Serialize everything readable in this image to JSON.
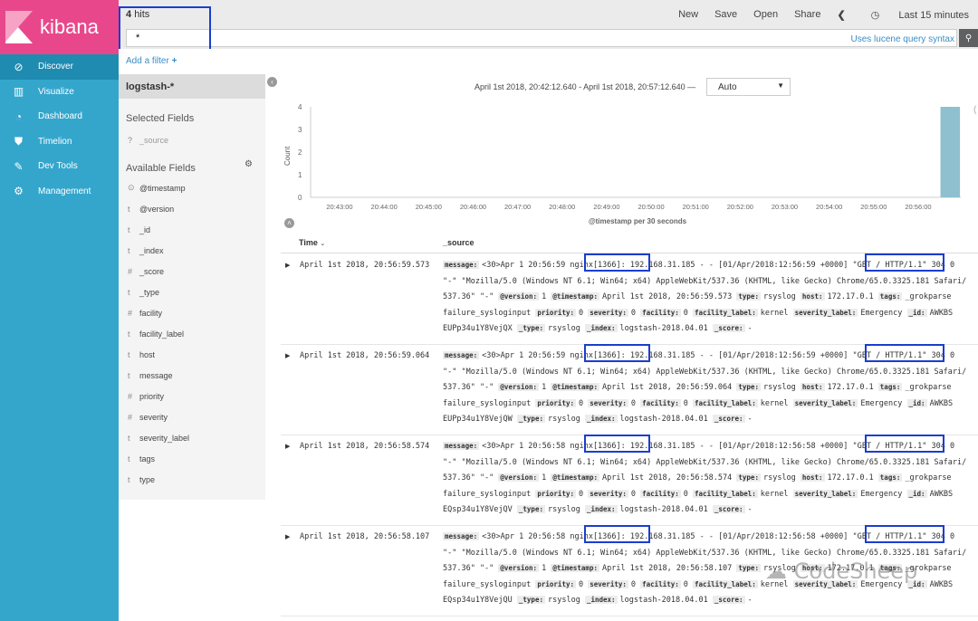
{
  "app": {
    "name": "kibana"
  },
  "nav": [
    {
      "label": "Discover",
      "icon": "compass-icon",
      "glyph": "⊘"
    },
    {
      "label": "Visualize",
      "icon": "bar-chart-icon",
      "glyph": "▥"
    },
    {
      "label": "Dashboard",
      "icon": "dashboard-icon",
      "glyph": "◔"
    },
    {
      "label": "Timelion",
      "icon": "timelion-icon",
      "glyph": "⛊"
    },
    {
      "label": "Dev Tools",
      "icon": "wrench-icon",
      "glyph": "✎"
    },
    {
      "label": "Management",
      "icon": "gear-icon",
      "glyph": "⚙"
    }
  ],
  "topbar": {
    "hits_count": "4",
    "hits_label": "hits",
    "actions": [
      "New",
      "Save",
      "Open",
      "Share"
    ],
    "time_picker": "Last 15 minutes"
  },
  "query": {
    "value": "*",
    "hint": "Uses lucene query syntax"
  },
  "filter": {
    "add_label": "Add a filter"
  },
  "sidebar": {
    "index_pattern": "logstash-*",
    "selected_title": "Selected Fields",
    "selected_fields": [
      {
        "type": "?",
        "name": "_source"
      }
    ],
    "available_title": "Available Fields",
    "available_fields": [
      {
        "type": "⊙",
        "name": "@timestamp"
      },
      {
        "type": "t",
        "name": "@version"
      },
      {
        "type": "t",
        "name": "_id"
      },
      {
        "type": "t",
        "name": "_index"
      },
      {
        "type": "#",
        "name": "_score"
      },
      {
        "type": "t",
        "name": "_type"
      },
      {
        "type": "#",
        "name": "facility"
      },
      {
        "type": "t",
        "name": "facility_label"
      },
      {
        "type": "t",
        "name": "host"
      },
      {
        "type": "t",
        "name": "message"
      },
      {
        "type": "#",
        "name": "priority"
      },
      {
        "type": "#",
        "name": "severity"
      },
      {
        "type": "t",
        "name": "severity_label"
      },
      {
        "type": "t",
        "name": "tags"
      },
      {
        "type": "t",
        "name": "type"
      }
    ]
  },
  "histogram": {
    "time_range": "April 1st 2018, 20:42:12.640 - April 1st 2018, 20:57:12.640 —",
    "interval": "Auto"
  },
  "chart_data": {
    "type": "bar",
    "ylabel": "Count",
    "xlabel": "@timestamp per 30 seconds",
    "ylim": [
      0,
      4
    ],
    "yticks": [
      "0",
      "1",
      "2",
      "3",
      "4"
    ],
    "xticks": [
      "20:43:00",
      "20:44:00",
      "20:45:00",
      "20:46:00",
      "20:47:00",
      "20:48:00",
      "20:49:00",
      "20:50:00",
      "20:51:00",
      "20:52:00",
      "20:53:00",
      "20:54:00",
      "20:55:00",
      "20:56:00"
    ],
    "bars": [
      {
        "x": "20:56:30",
        "value": 4
      }
    ],
    "bar_color": "#8ec0d0"
  },
  "table": {
    "col_time": "Time",
    "col_source": "_source",
    "rows": [
      {
        "time": "April 1st 2018, 20:56:59.573",
        "lines": [
          [
            [
              "k",
              "message:"
            ],
            [
              "v",
              "<30>Apr 1 20:56:59 nginx[1366]: 192.168.31.185 - - [01/Apr/2018:12:56:59 +0000] \"GET / HTTP/1.1\" 304 0"
            ]
          ],
          [
            [
              "v",
              "\"-\" \"Mozilla/5.0 (Windows NT 6.1; Win64; x64) AppleWebKit/537.36 (KHTML, like Gecko) Chrome/65.0.3325.181 Safari/"
            ]
          ],
          [
            [
              "v",
              "537.36\" \"-\" "
            ],
            [
              "k",
              "@version:"
            ],
            [
              "v",
              "1 "
            ],
            [
              "k",
              "@timestamp:"
            ],
            [
              "v",
              "April 1st 2018, 20:56:59.573 "
            ],
            [
              "k",
              "type:"
            ],
            [
              "v",
              "rsyslog "
            ],
            [
              "k",
              "host:"
            ],
            [
              "v",
              "172.17.0.1 "
            ],
            [
              "k",
              "tags:"
            ],
            [
              "v",
              "_grokparse"
            ]
          ],
          [
            [
              "v",
              "failure_sysloginput "
            ],
            [
              "k",
              "priority:"
            ],
            [
              "v",
              "0 "
            ],
            [
              "k",
              "severity:"
            ],
            [
              "v",
              "0 "
            ],
            [
              "k",
              "facility:"
            ],
            [
              "v",
              "0 "
            ],
            [
              "k",
              "facility_label:"
            ],
            [
              "v",
              "kernel "
            ],
            [
              "k",
              "severity_label:"
            ],
            [
              "v",
              "Emergency "
            ],
            [
              "k",
              "_id:"
            ],
            [
              "v",
              "AWKBS"
            ]
          ],
          [
            [
              "v",
              "EUPp34u1Y8VejQX "
            ],
            [
              "k",
              "_type:"
            ],
            [
              "v",
              "rsyslog "
            ],
            [
              "k",
              "_index:"
            ],
            [
              "v",
              "logstash-2018.04.01 "
            ],
            [
              "k",
              "_score:"
            ],
            [
              "v",
              "-"
            ]
          ]
        ]
      },
      {
        "time": "April 1st 2018, 20:56:59.064",
        "lines": [
          [
            [
              "k",
              "message:"
            ],
            [
              "v",
              "<30>Apr 1 20:56:59 nginx[1366]: 192.168.31.185 - - [01/Apr/2018:12:56:59 +0000] \"GET / HTTP/1.1\" 304 0"
            ]
          ],
          [
            [
              "v",
              "\"-\" \"Mozilla/5.0 (Windows NT 6.1; Win64; x64) AppleWebKit/537.36 (KHTML, like Gecko) Chrome/65.0.3325.181 Safari/"
            ]
          ],
          [
            [
              "v",
              "537.36\" \"-\" "
            ],
            [
              "k",
              "@version:"
            ],
            [
              "v",
              "1 "
            ],
            [
              "k",
              "@timestamp:"
            ],
            [
              "v",
              "April 1st 2018, 20:56:59.064 "
            ],
            [
              "k",
              "type:"
            ],
            [
              "v",
              "rsyslog "
            ],
            [
              "k",
              "host:"
            ],
            [
              "v",
              "172.17.0.1 "
            ],
            [
              "k",
              "tags:"
            ],
            [
              "v",
              "_grokparse"
            ]
          ],
          [
            [
              "v",
              "failure_sysloginput "
            ],
            [
              "k",
              "priority:"
            ],
            [
              "v",
              "0 "
            ],
            [
              "k",
              "severity:"
            ],
            [
              "v",
              "0 "
            ],
            [
              "k",
              "facility:"
            ],
            [
              "v",
              "0 "
            ],
            [
              "k",
              "facility_label:"
            ],
            [
              "v",
              "kernel "
            ],
            [
              "k",
              "severity_label:"
            ],
            [
              "v",
              "Emergency "
            ],
            [
              "k",
              "_id:"
            ],
            [
              "v",
              "AWKBS"
            ]
          ],
          [
            [
              "v",
              "EUPp34u1Y8VejQW "
            ],
            [
              "k",
              "_type:"
            ],
            [
              "v",
              "rsyslog "
            ],
            [
              "k",
              "_index:"
            ],
            [
              "v",
              "logstash-2018.04.01 "
            ],
            [
              "k",
              "_score:"
            ],
            [
              "v",
              "-"
            ]
          ]
        ]
      },
      {
        "time": "April 1st 2018, 20:56:58.574",
        "lines": [
          [
            [
              "k",
              "message:"
            ],
            [
              "v",
              "<30>Apr 1 20:56:58 nginx[1366]: 192.168.31.185 - - [01/Apr/2018:12:56:58 +0000] \"GET / HTTP/1.1\" 304 0"
            ]
          ],
          [
            [
              "v",
              "\"-\" \"Mozilla/5.0 (Windows NT 6.1; Win64; x64) AppleWebKit/537.36 (KHTML, like Gecko) Chrome/65.0.3325.181 Safari/"
            ]
          ],
          [
            [
              "v",
              "537.36\" \"-\" "
            ],
            [
              "k",
              "@version:"
            ],
            [
              "v",
              "1 "
            ],
            [
              "k",
              "@timestamp:"
            ],
            [
              "v",
              "April 1st 2018, 20:56:58.574 "
            ],
            [
              "k",
              "type:"
            ],
            [
              "v",
              "rsyslog "
            ],
            [
              "k",
              "host:"
            ],
            [
              "v",
              "172.17.0.1 "
            ],
            [
              "k",
              "tags:"
            ],
            [
              "v",
              "_grokparse"
            ]
          ],
          [
            [
              "v",
              "failure_sysloginput "
            ],
            [
              "k",
              "priority:"
            ],
            [
              "v",
              "0 "
            ],
            [
              "k",
              "severity:"
            ],
            [
              "v",
              "0 "
            ],
            [
              "k",
              "facility:"
            ],
            [
              "v",
              "0 "
            ],
            [
              "k",
              "facility_label:"
            ],
            [
              "v",
              "kernel "
            ],
            [
              "k",
              "severity_label:"
            ],
            [
              "v",
              "Emergency "
            ],
            [
              "k",
              "_id:"
            ],
            [
              "v",
              "AWKBS"
            ]
          ],
          [
            [
              "v",
              "EQsp34u1Y8VejQV "
            ],
            [
              "k",
              "_type:"
            ],
            [
              "v",
              "rsyslog "
            ],
            [
              "k",
              "_index:"
            ],
            [
              "v",
              "logstash-2018.04.01 "
            ],
            [
              "k",
              "_score:"
            ],
            [
              "v",
              "-"
            ]
          ]
        ]
      },
      {
        "time": "April 1st 2018, 20:56:58.107",
        "lines": [
          [
            [
              "k",
              "message:"
            ],
            [
              "v",
              "<30>Apr 1 20:56:58 nginx[1366]: 192.168.31.185 - - [01/Apr/2018:12:56:58 +0000] \"GET / HTTP/1.1\" 304 0"
            ]
          ],
          [
            [
              "v",
              "\"-\" \"Mozilla/5.0 (Windows NT 6.1; Win64; x64) AppleWebKit/537.36 (KHTML, like Gecko) Chrome/65.0.3325.181 Safari/"
            ]
          ],
          [
            [
              "v",
              "537.36\" \"-\" "
            ],
            [
              "k",
              "@version:"
            ],
            [
              "v",
              "1 "
            ],
            [
              "k",
              "@timestamp:"
            ],
            [
              "v",
              "April 1st 2018, 20:56:58.107 "
            ],
            [
              "k",
              "type:"
            ],
            [
              "v",
              "rsyslog "
            ],
            [
              "k",
              "host:"
            ],
            [
              "v",
              "172.17.0.1 "
            ],
            [
              "k",
              "tags:"
            ],
            [
              "v",
              "_grokparse"
            ]
          ],
          [
            [
              "v",
              "failure_sysloginput "
            ],
            [
              "k",
              "priority:"
            ],
            [
              "v",
              "0 "
            ],
            [
              "k",
              "severity:"
            ],
            [
              "v",
              "0 "
            ],
            [
              "k",
              "facility:"
            ],
            [
              "v",
              "0 "
            ],
            [
              "k",
              "facility_label:"
            ],
            [
              "v",
              "kernel "
            ],
            [
              "k",
              "severity_label:"
            ],
            [
              "v",
              "Emergency "
            ],
            [
              "k",
              "_id:"
            ],
            [
              "v",
              "AWKBS"
            ]
          ],
          [
            [
              "v",
              "EQsp34u1Y8VejQU "
            ],
            [
              "k",
              "_type:"
            ],
            [
              "v",
              "rsyslog "
            ],
            [
              "k",
              "_index:"
            ],
            [
              "v",
              "logstash-2018.04.01 "
            ],
            [
              "k",
              "_score:"
            ],
            [
              "v",
              "-"
            ]
          ]
        ]
      }
    ]
  },
  "watermark": "CodeSheep"
}
